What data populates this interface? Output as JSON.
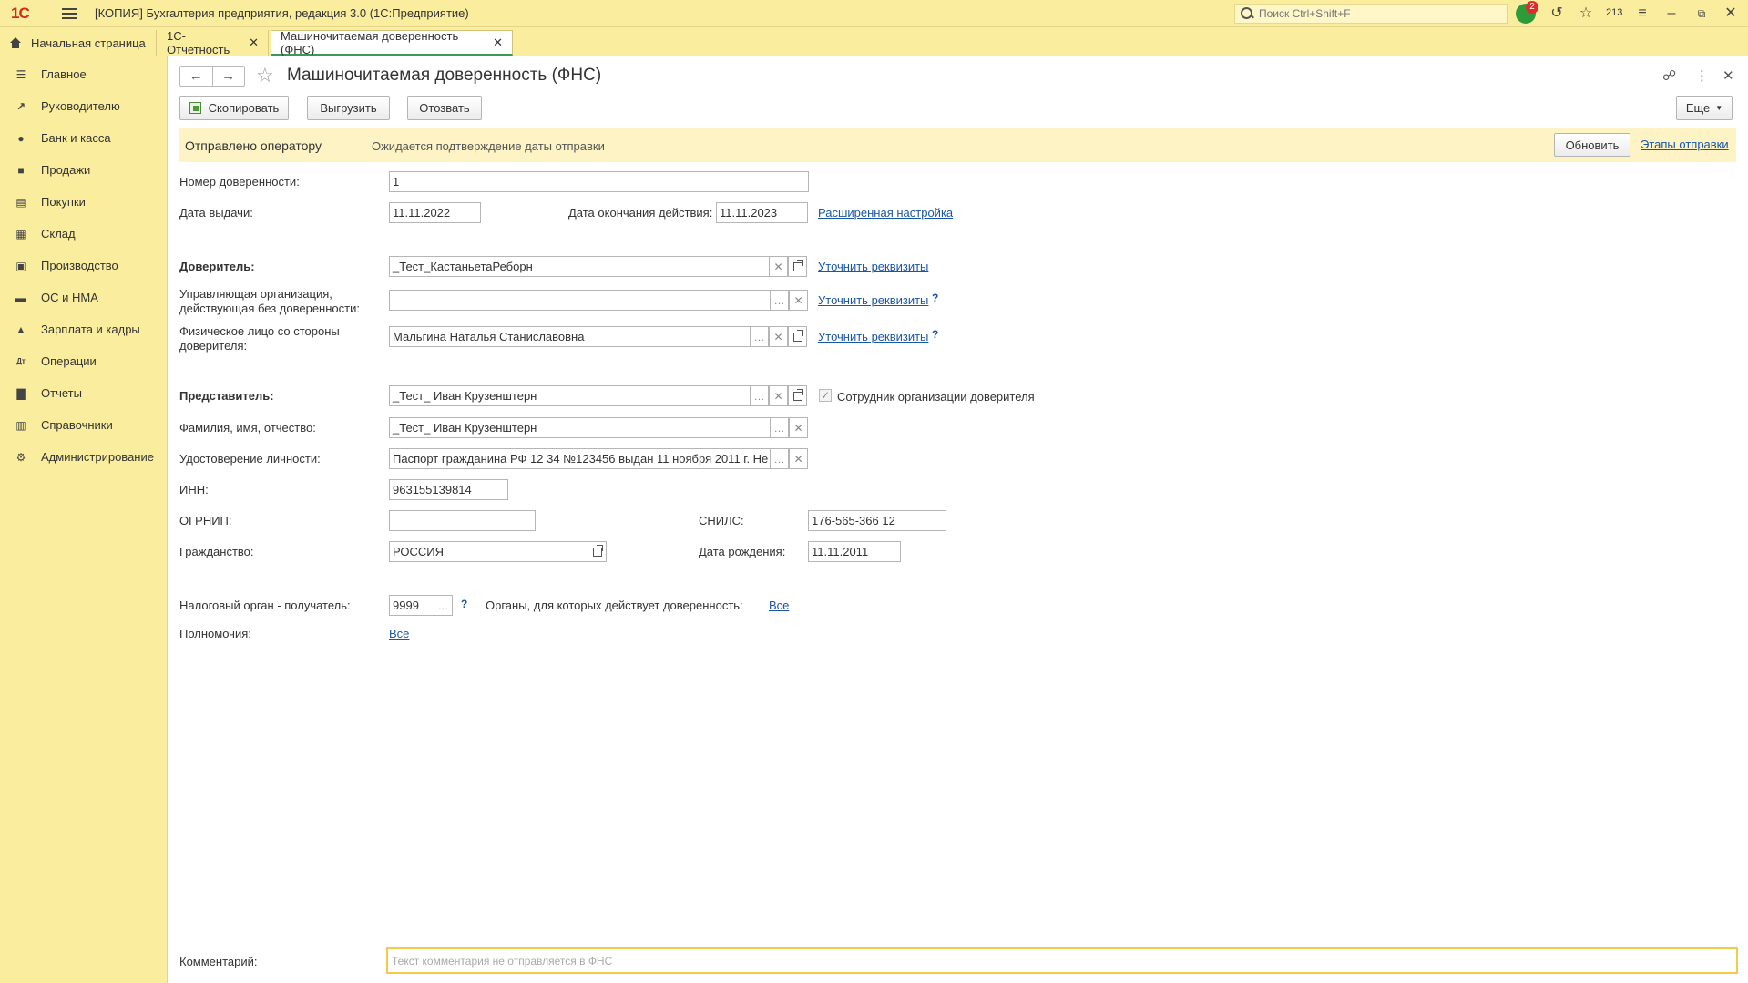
{
  "app": {
    "logo": "1С",
    "title": "[КОПИЯ] Бухгалтерия предприятия, редакция 3.0  (1С:Предприятие)",
    "search_placeholder": "Поиск Ctrl+Shift+F",
    "notifications_count": "2",
    "favorites_count": "213"
  },
  "tabs": [
    {
      "label": "Начальная страница"
    },
    {
      "label": "1С-Отчетность"
    },
    {
      "label": "Машиночитаемая доверенность (ФНС)"
    }
  ],
  "sidebar": {
    "items": [
      {
        "label": "Главное",
        "icon": "menu-icon"
      },
      {
        "label": "Руководителю",
        "icon": "trend-icon"
      },
      {
        "label": "Банк и касса",
        "icon": "coin-icon"
      },
      {
        "label": "Продажи",
        "icon": "bag-icon"
      },
      {
        "label": "Покупки",
        "icon": "cart-icon"
      },
      {
        "label": "Склад",
        "icon": "grid-icon"
      },
      {
        "label": "Производство",
        "icon": "factory-icon"
      },
      {
        "label": "ОС и НМА",
        "icon": "truck-icon"
      },
      {
        "label": "Зарплата и кадры",
        "icon": "person-icon"
      },
      {
        "label": "Операции",
        "icon": "dtkt-icon"
      },
      {
        "label": "Отчеты",
        "icon": "bars-icon"
      },
      {
        "label": "Справочники",
        "icon": "book-icon"
      },
      {
        "label": "Администрирование",
        "icon": "gear-icon"
      }
    ]
  },
  "form": {
    "title": "Машиночитаемая доверенность (ФНС)",
    "buttons": {
      "copy": "Скопировать",
      "export": "Выгрузить",
      "revoke": "Отозвать",
      "more": "Еще",
      "refresh": "Обновить"
    },
    "status": {
      "main": "Отправлено оператору",
      "sub": "Ожидается подтверждение даты отправки",
      "stages_link": "Этапы отправки"
    },
    "labels": {
      "number": "Номер доверенности:",
      "issue_date": "Дата выдачи:",
      "end_date": "Дата окончания действия:",
      "advanced": "Расширенная настройка",
      "principal": "Доверитель:",
      "managing_org_1": "Управляющая организация,",
      "managing_org_2": "действующая без доверенности:",
      "individual_1": "Физическое лицо со стороны",
      "individual_2": "доверителя:",
      "clarify": "Уточнить реквизиты",
      "representative": "Представитель:",
      "employee": "Сотрудник организации доверителя",
      "fio": "Фамилия, имя, отчество:",
      "id_doc": "Удостоверение личности:",
      "inn": "ИНН:",
      "ogrnip": "ОГРНИП:",
      "snils": "СНИЛС:",
      "citizenship": "Гражданство:",
      "birth_date": "Дата рождения:",
      "tax_authority": "Налоговый орган - получатель:",
      "authorities": "Органы, для которых действует доверенность:",
      "powers": "Полномочия:",
      "all": "Все",
      "comment": "Комментарий:"
    },
    "values": {
      "number": "1",
      "issue_date": "11.11.2022",
      "end_date": "11.11.2023",
      "principal": "_Тест_КастаньетаРеборн",
      "managing_org": "",
      "individual": "Мальгина Наталья Станиславовна",
      "representative": "_Тест_ Иван Крузенштерн",
      "fio": "_Тест_ Иван Крузенштерн",
      "id_doc": "Паспорт гражданина РФ 12 34 №123456 выдан 11 ноября 2011 г. Не",
      "inn": "963155139814",
      "ogrnip": "",
      "snils": "176-565-366 12",
      "citizenship": "РОССИЯ",
      "birth_date": "11.11.2011",
      "tax_authority": "9999",
      "comment_placeholder": "Текст комментария не отправляется в ФНС"
    }
  }
}
